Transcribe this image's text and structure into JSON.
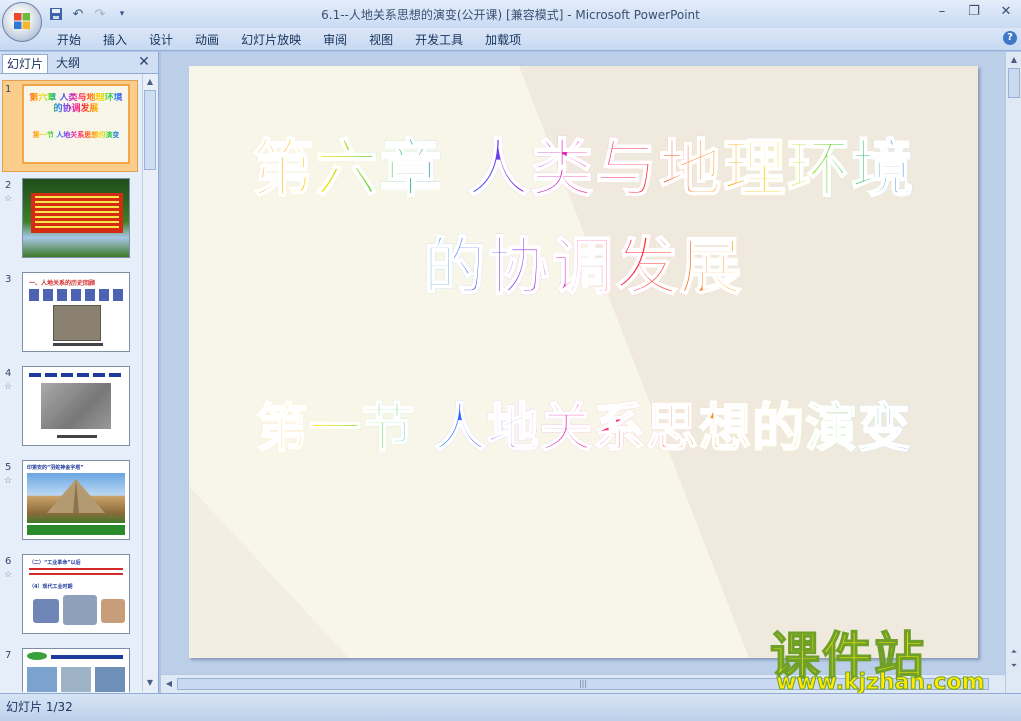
{
  "app": {
    "window_title": "6.1--人地关系思想的演变(公开课) [兼容模式] - Microsoft PowerPoint"
  },
  "quick_access": [
    "save-icon",
    "undo-icon",
    "redo-icon",
    "customize-icon"
  ],
  "window_controls": [
    "minimize-icon",
    "restore-icon",
    "close-icon"
  ],
  "ribbon": {
    "tabs": [
      "开始",
      "插入",
      "设计",
      "动画",
      "幻灯片放映",
      "审阅",
      "视图",
      "开发工具",
      "加载项"
    ]
  },
  "left_pane": {
    "tabs": [
      "幻灯片",
      "大纲"
    ],
    "slide_numbers": [
      "1",
      "2",
      "3",
      "4",
      "5",
      "6",
      "7"
    ],
    "thumb1": {
      "title": "第六章 人类与地理环境的协调发展",
      "subtitle": "第一节 人地关系思想的演变"
    },
    "thumb3": {
      "heading": "一、人地关系的历史回顾"
    },
    "thumb5": {
      "heading": "印第安的“羽蛇神金字塔”"
    },
    "thumb6": {
      "line1": "（二）“工业革命”以后",
      "line2": "（4）现代工业时期"
    }
  },
  "slide": {
    "title_line1": "第六章 人类与地理环境",
    "title_line2": "的协调发展",
    "subtitle": "第一节 人地关系思想的演变"
  },
  "watermark": {
    "main": "课件站",
    "url": "www.kjzhan.com"
  },
  "status": {
    "slide_indicator": "幻灯片 1/32"
  },
  "colors": {
    "ribbon": "#c6d8f1",
    "slide_bg": "#f8f5e9",
    "selected_thumb": "#fbcd8b",
    "watermark": "#ffea00"
  }
}
